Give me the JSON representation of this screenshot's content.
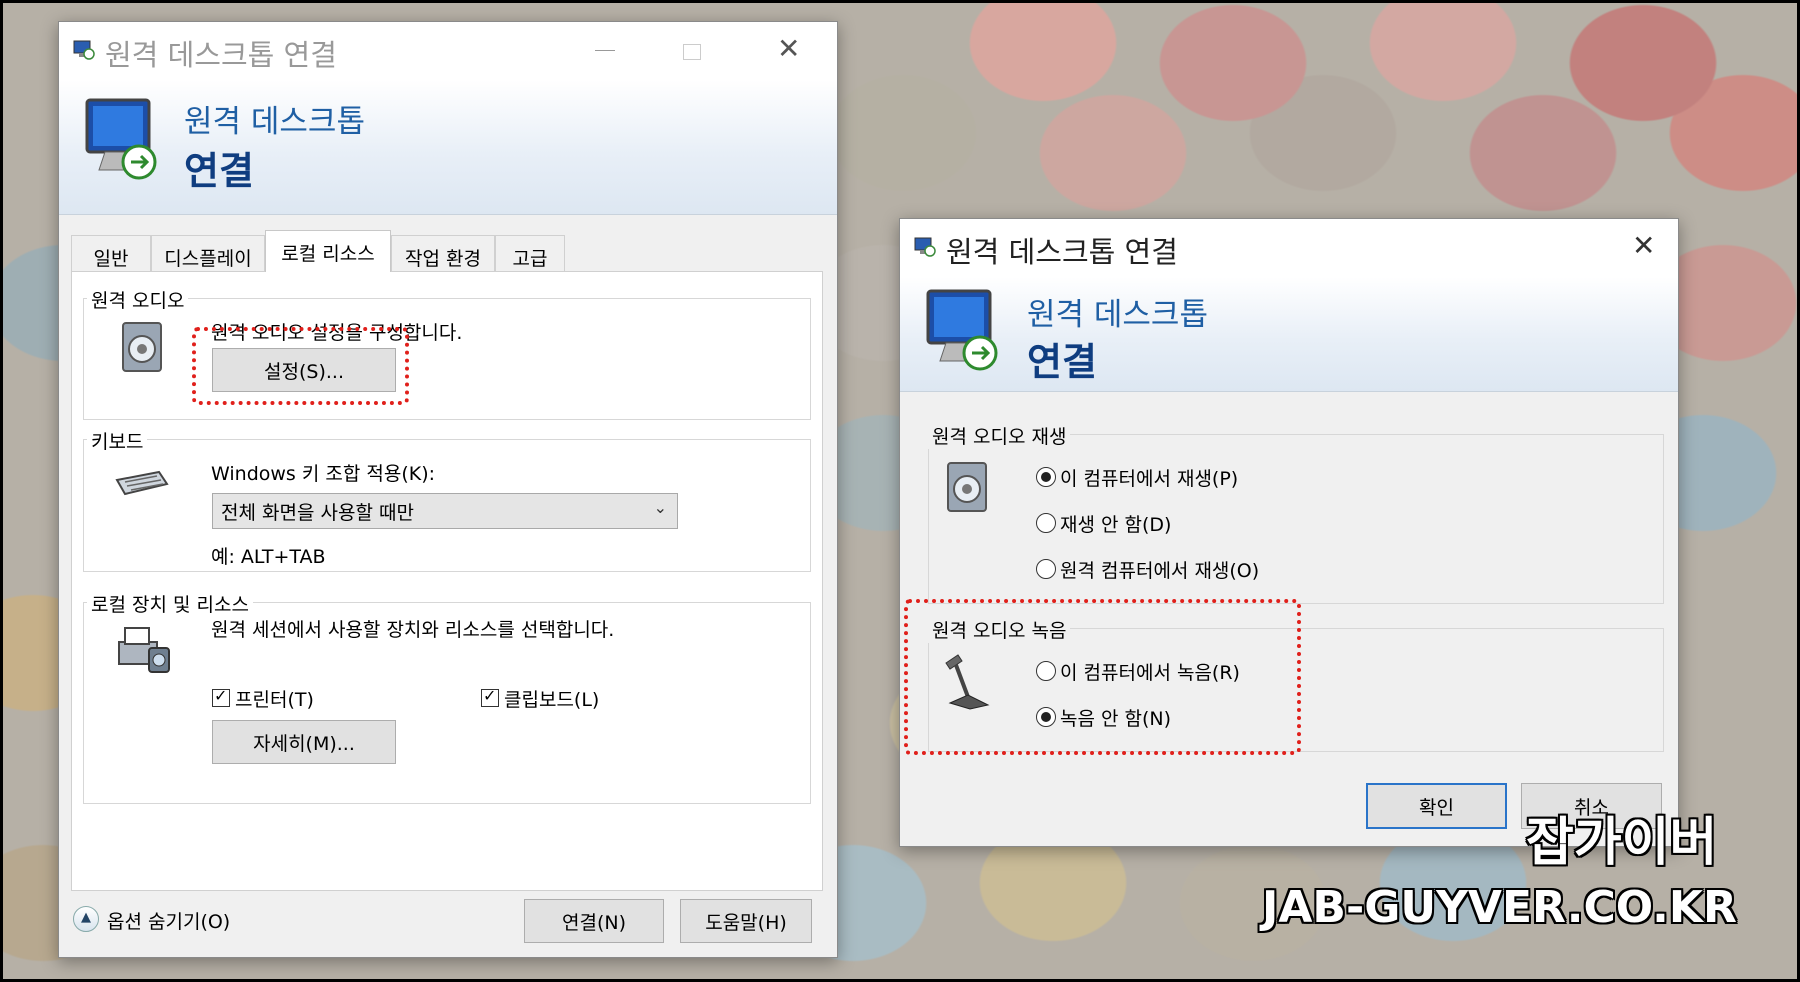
{
  "left_window": {
    "title": "원격 데스크톱 연결",
    "banner_sub": "원격 데스크톱",
    "banner_main": "연결",
    "tabs": [
      {
        "label": "일반"
      },
      {
        "label": "디스플레이"
      },
      {
        "label": "로컬 리소스"
      },
      {
        "label": "작업 환경"
      },
      {
        "label": "고급"
      }
    ],
    "active_tab": "로컬 리소스",
    "audio_group": {
      "label": "원격 오디오",
      "description": "원격 오디오 설정을 구성합니다.",
      "settings_button": "설정(S)..."
    },
    "keyboard_group": {
      "label": "키보드",
      "field_label": "Windows 키 조합 적용(K):",
      "selected": "전체 화면을 사용할 때만",
      "example": "예: ALT+TAB"
    },
    "devices_group": {
      "label": "로컬 장치 및 리소스",
      "description": "원격 세션에서 사용할 장치와 리소스를 선택합니다.",
      "printer": "프린터(T)",
      "clipboard": "클립보드(L)",
      "more_button": "자세히(M)..."
    },
    "footer": {
      "options_toggle": "옵션 숨기기(O)",
      "connect_button": "연결(N)",
      "help_button": "도움말(H)"
    }
  },
  "right_window": {
    "title": "원격 데스크톱 연결",
    "banner_sub": "원격 데스크톱",
    "banner_main": "연결",
    "playback_group": {
      "label": "원격 오디오 재생",
      "options": [
        {
          "label": "이 컴퓨터에서 재생(P)",
          "selected": true
        },
        {
          "label": "재생 안 함(D)",
          "selected": false
        },
        {
          "label": "원격 컴퓨터에서 재생(O)",
          "selected": false
        }
      ]
    },
    "recording_group": {
      "label": "원격 오디오 녹음",
      "options": [
        {
          "label": "이 컴퓨터에서 녹음(R)",
          "selected": false
        },
        {
          "label": "녹음 안 함(N)",
          "selected": true
        }
      ]
    },
    "ok_button": "확인",
    "cancel_button": "취소"
  },
  "watermark": {
    "line1": "잡가이버",
    "line2": "JAB-GUYVER.CO.KR"
  },
  "colors": {
    "highlight": "#e0201b",
    "banner_text": "#0f3d80",
    "default_button_border": "#2a74c9"
  }
}
